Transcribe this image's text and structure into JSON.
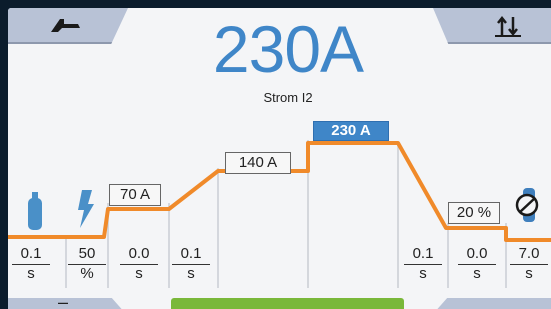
{
  "header": {
    "left_tab_icon": "torch-icon",
    "right_tab_icon": "sort-arrows-icon",
    "current_value": "230A",
    "current_label": "Strom I2"
  },
  "process": {
    "left_icons": [
      "gas-cylinder-icon",
      "lightning-icon"
    ],
    "right_icons": [
      "gas-cylinder-off-icon"
    ],
    "level_labels": {
      "start": "70 A",
      "i1": "140 A",
      "i2": "230 A",
      "end": "20 %"
    },
    "params": [
      {
        "value": "0.1",
        "unit": "s"
      },
      {
        "value": "50",
        "unit": "%"
      },
      {
        "value": "0.0",
        "unit": "s"
      },
      {
        "value": "0.1",
        "unit": "s"
      },
      {
        "value": "0.1",
        "unit": "s"
      },
      {
        "value": "0.0",
        "unit": "s"
      },
      {
        "value": "7.0",
        "unit": "s"
      }
    ],
    "colors": {
      "curve": "#f08a2a",
      "accent": "#3f86c8",
      "confirm": "#7ab83a"
    }
  },
  "footer": {
    "minus_label": "–"
  }
}
